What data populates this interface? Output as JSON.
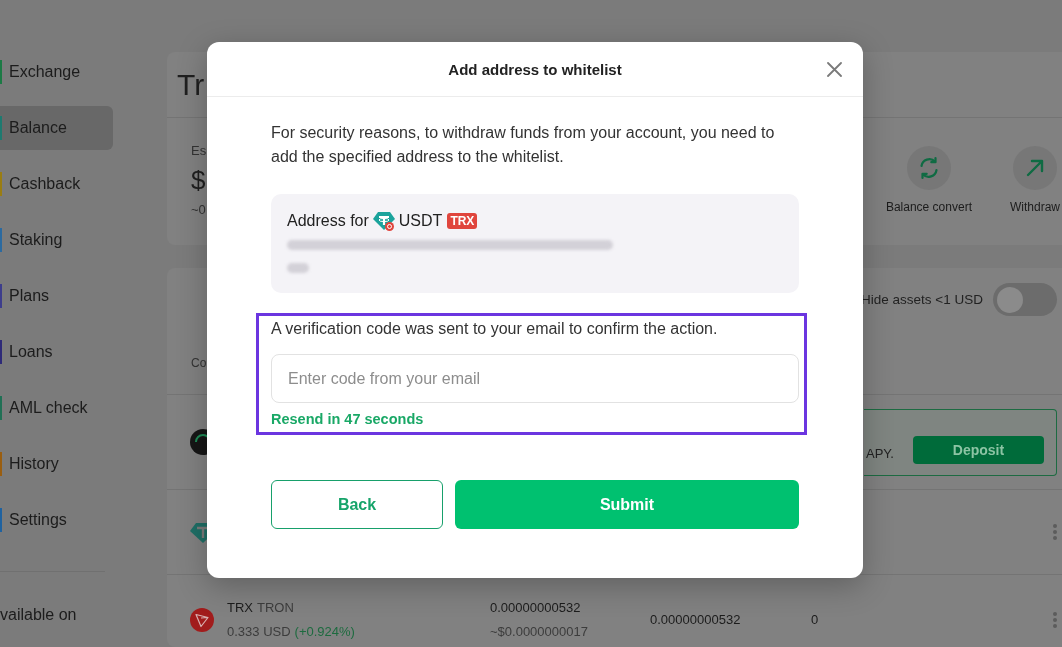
{
  "sidebar": {
    "items": [
      {
        "label": "Exchange",
        "color": "#1c7a45",
        "selected": false
      },
      {
        "label": "Balance",
        "color": "#1e7a70",
        "selected": true
      },
      {
        "label": "Cashback",
        "color": "#9a7d12",
        "selected": false
      },
      {
        "label": "Staking",
        "color": "#2b6aa0",
        "selected": false
      },
      {
        "label": "Plans",
        "color": "#3d3d8c",
        "selected": false
      },
      {
        "label": "Loans",
        "color": "#2e2a78",
        "selected": false
      },
      {
        "label": "AML check",
        "color": "#207055",
        "selected": false
      },
      {
        "label": "History",
        "color": "#9a5e10",
        "selected": false
      },
      {
        "label": "Settings",
        "color": "#1f62a0",
        "selected": false
      }
    ],
    "footer": "vailable on"
  },
  "balance_card": {
    "title": "Tr",
    "label": "Es",
    "amount": "$",
    "amount_note": "~0",
    "actions": [
      {
        "label": "Balance convert",
        "kind": "convert"
      },
      {
        "label": "Withdraw",
        "kind": "withdraw"
      }
    ]
  },
  "assets_card": {
    "hide_small": {
      "label": "Hide assets <1 USD",
      "on": false
    },
    "column_1": "Co",
    "rows": [
      {
        "kind": "not",
        "promo": {
          "text": "APY.",
          "button": "Deposit"
        }
      },
      {
        "kind": "usdt"
      },
      {
        "kind": "trx",
        "symbol": "TRX",
        "name": "TRON",
        "price": "0.333 USD",
        "change": "(+0.924%)",
        "amount": "0.00000000532",
        "amount_usd": "~$0.0000000017",
        "column_3": "0.00000000532",
        "column_4": "0"
      }
    ]
  },
  "dialog": {
    "title": "Add address to whitelist",
    "intro": "For security reasons, to withdraw funds from your account, you need to add the specified address to the whitelist.",
    "address": {
      "label": "Address for",
      "coin": "USDT",
      "network": "TRX"
    },
    "verification": {
      "message": "A verification code was sent to your email to confirm the action.",
      "placeholder": "Enter code from your email",
      "resend": "Resend in 47 seconds"
    },
    "buttons": [
      {
        "label": "Back",
        "kind": "secondary"
      },
      {
        "label": "Submit",
        "kind": "primary"
      }
    ]
  }
}
